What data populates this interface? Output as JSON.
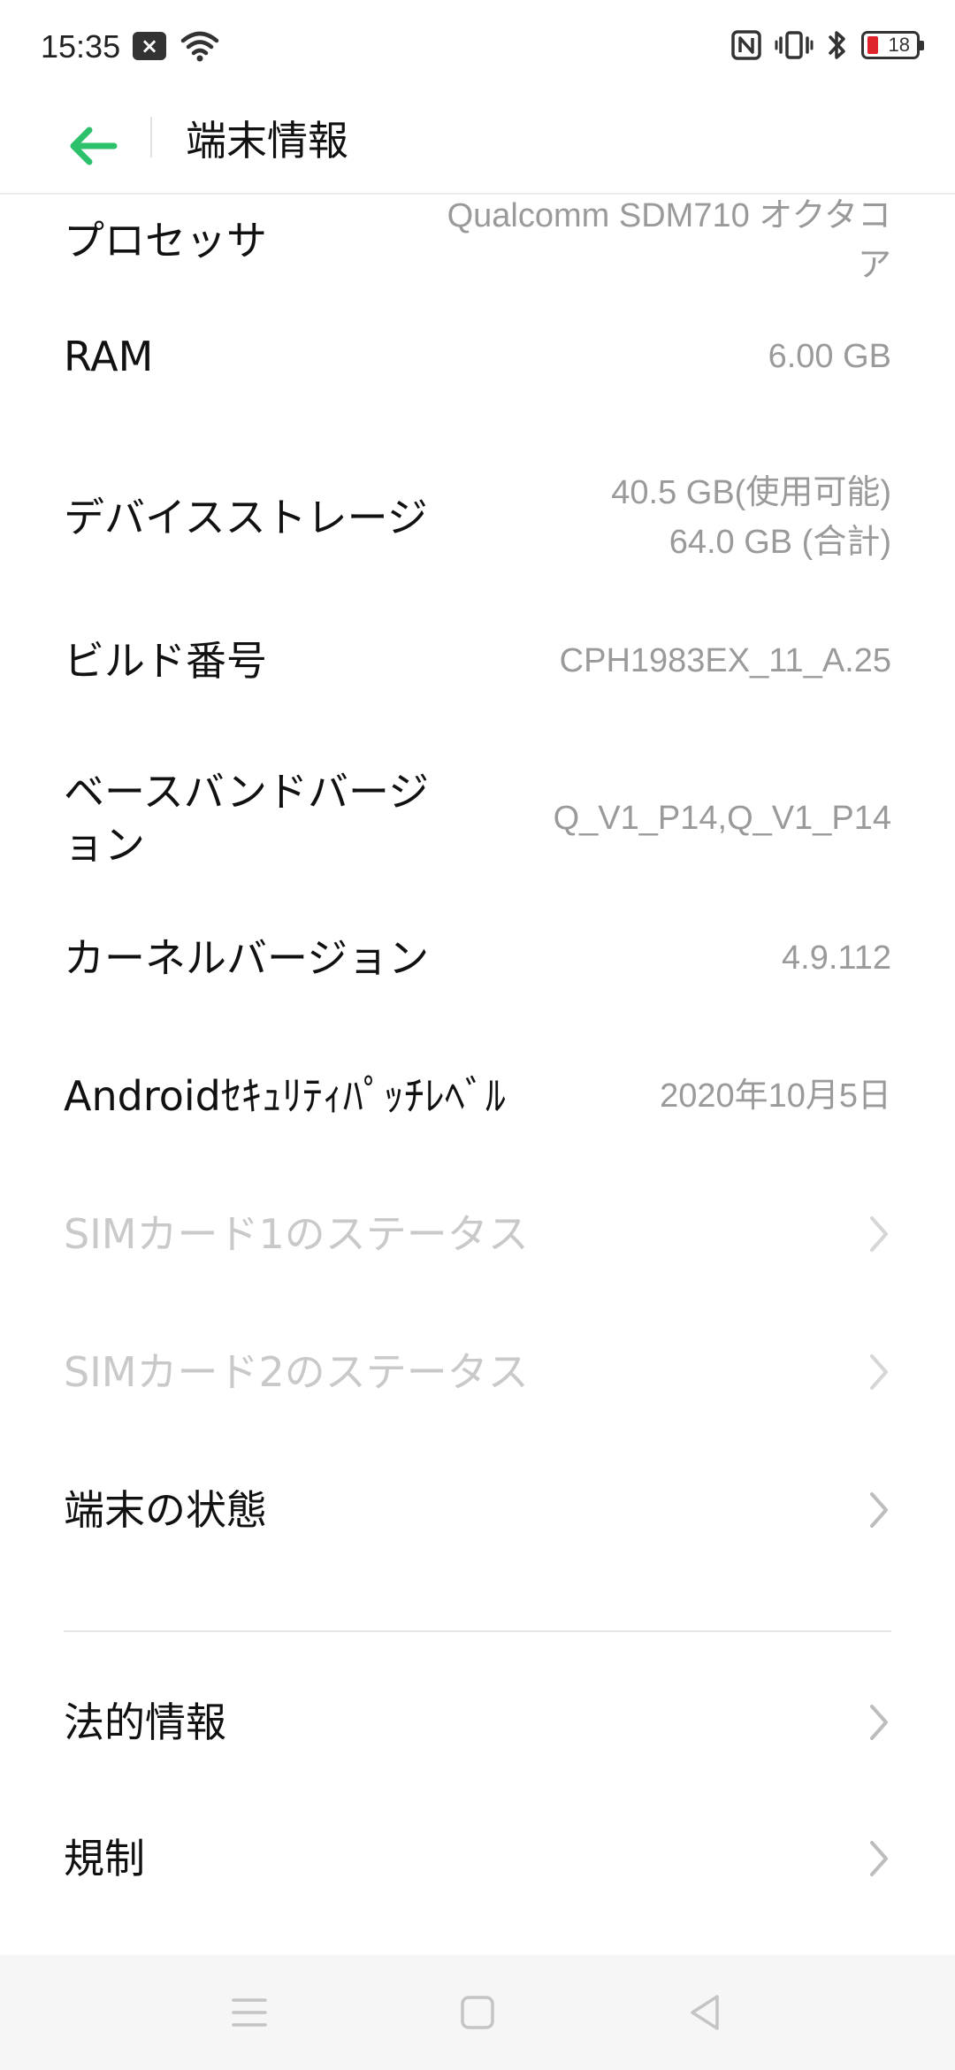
{
  "status_bar": {
    "time": "15:35",
    "battery_level": "18",
    "left_icons": [
      "notification-close-icon",
      "wifi-icon"
    ],
    "right_icons": [
      "nfc-icon",
      "vibrate-icon",
      "bluetooth-icon",
      "battery-icon"
    ]
  },
  "header": {
    "title": "端末情報",
    "back_icon": "back-arrow-icon",
    "accent_color": "#2dc16c"
  },
  "rows": [
    {
      "label": "プロセッサ",
      "value": [
        "Qualcomm SDM710 オクタコ",
        "ア"
      ],
      "disabled": false,
      "chevron": false
    },
    {
      "label": "RAM",
      "value": [
        "6.00 GB"
      ],
      "disabled": false,
      "chevron": false
    },
    {
      "label": "デバイスストレージ",
      "value": [
        "40.5 GB(使用可能)",
        "64.0 GB (合計)"
      ],
      "disabled": false,
      "chevron": false
    },
    {
      "label": "ビルド番号",
      "value": [
        "CPH1983EX_11_A.25"
      ],
      "disabled": false,
      "chevron": false
    },
    {
      "label": [
        "ベースバンドバージ",
        "ョン"
      ],
      "value": [
        "Q_V1_P14,Q_V1_P14"
      ],
      "disabled": false,
      "chevron": false
    },
    {
      "label": "カーネルバージョン",
      "value": [
        "4.9.112"
      ],
      "disabled": false,
      "chevron": false
    },
    {
      "label": "Androidｾｷｭﾘﾃｨﾊﾟｯﾁﾚﾍﾞﾙ",
      "value": [
        "2020年10月5日"
      ],
      "disabled": false,
      "chevron": false
    },
    {
      "label": "SIMカード1のステータス",
      "disabled": true,
      "chevron": true
    },
    {
      "label": "SIMカード2のステータス",
      "disabled": true,
      "chevron": true
    },
    {
      "label": "端末の状態",
      "disabled": false,
      "chevron": true
    },
    {
      "label": "法的情報",
      "disabled": false,
      "chevron": true
    },
    {
      "label": "規制",
      "disabled": false,
      "chevron": true
    }
  ],
  "nav_bar": {
    "buttons": [
      "menu-icon",
      "home-icon",
      "back-triangle-icon"
    ]
  }
}
